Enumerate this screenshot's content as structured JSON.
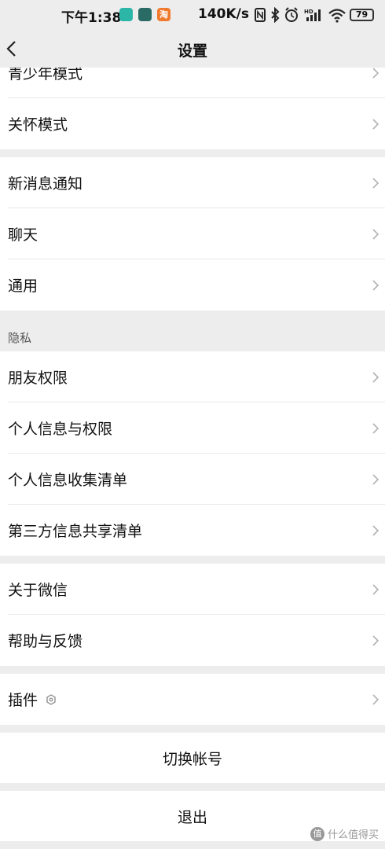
{
  "status_bar": {
    "time": "下午1:38",
    "net_speed": "140K/s",
    "battery": "79",
    "app_icons": [
      {
        "name": "shield-app-icon",
        "color": "#2bb6a8"
      },
      {
        "name": "book-app-icon",
        "color": "#2a6b66"
      },
      {
        "name": "taobao-app-icon",
        "color": "#f07a2c"
      }
    ],
    "taobao_glyph": "淘"
  },
  "navbar": {
    "title": "设置"
  },
  "groups": [
    {
      "items": [
        {
          "label": "青少年模式"
        },
        {
          "label": "关怀模式"
        }
      ]
    },
    {
      "items": [
        {
          "label": "新消息通知"
        },
        {
          "label": "聊天"
        },
        {
          "label": "通用"
        }
      ]
    },
    {
      "header": "隐私",
      "items": [
        {
          "label": "朋友权限"
        },
        {
          "label": "个人信息与权限"
        },
        {
          "label": "个人信息收集清单"
        },
        {
          "label": "第三方信息共享清单"
        }
      ]
    },
    {
      "items": [
        {
          "label": "关于微信"
        },
        {
          "label": "帮助与反馈"
        }
      ]
    },
    {
      "items": [
        {
          "label": "插件"
        }
      ]
    }
  ],
  "actions": {
    "switch_account": "切换帐号",
    "logout": "退出"
  },
  "watermark": {
    "glyph": "值",
    "text": "什么值得买"
  }
}
